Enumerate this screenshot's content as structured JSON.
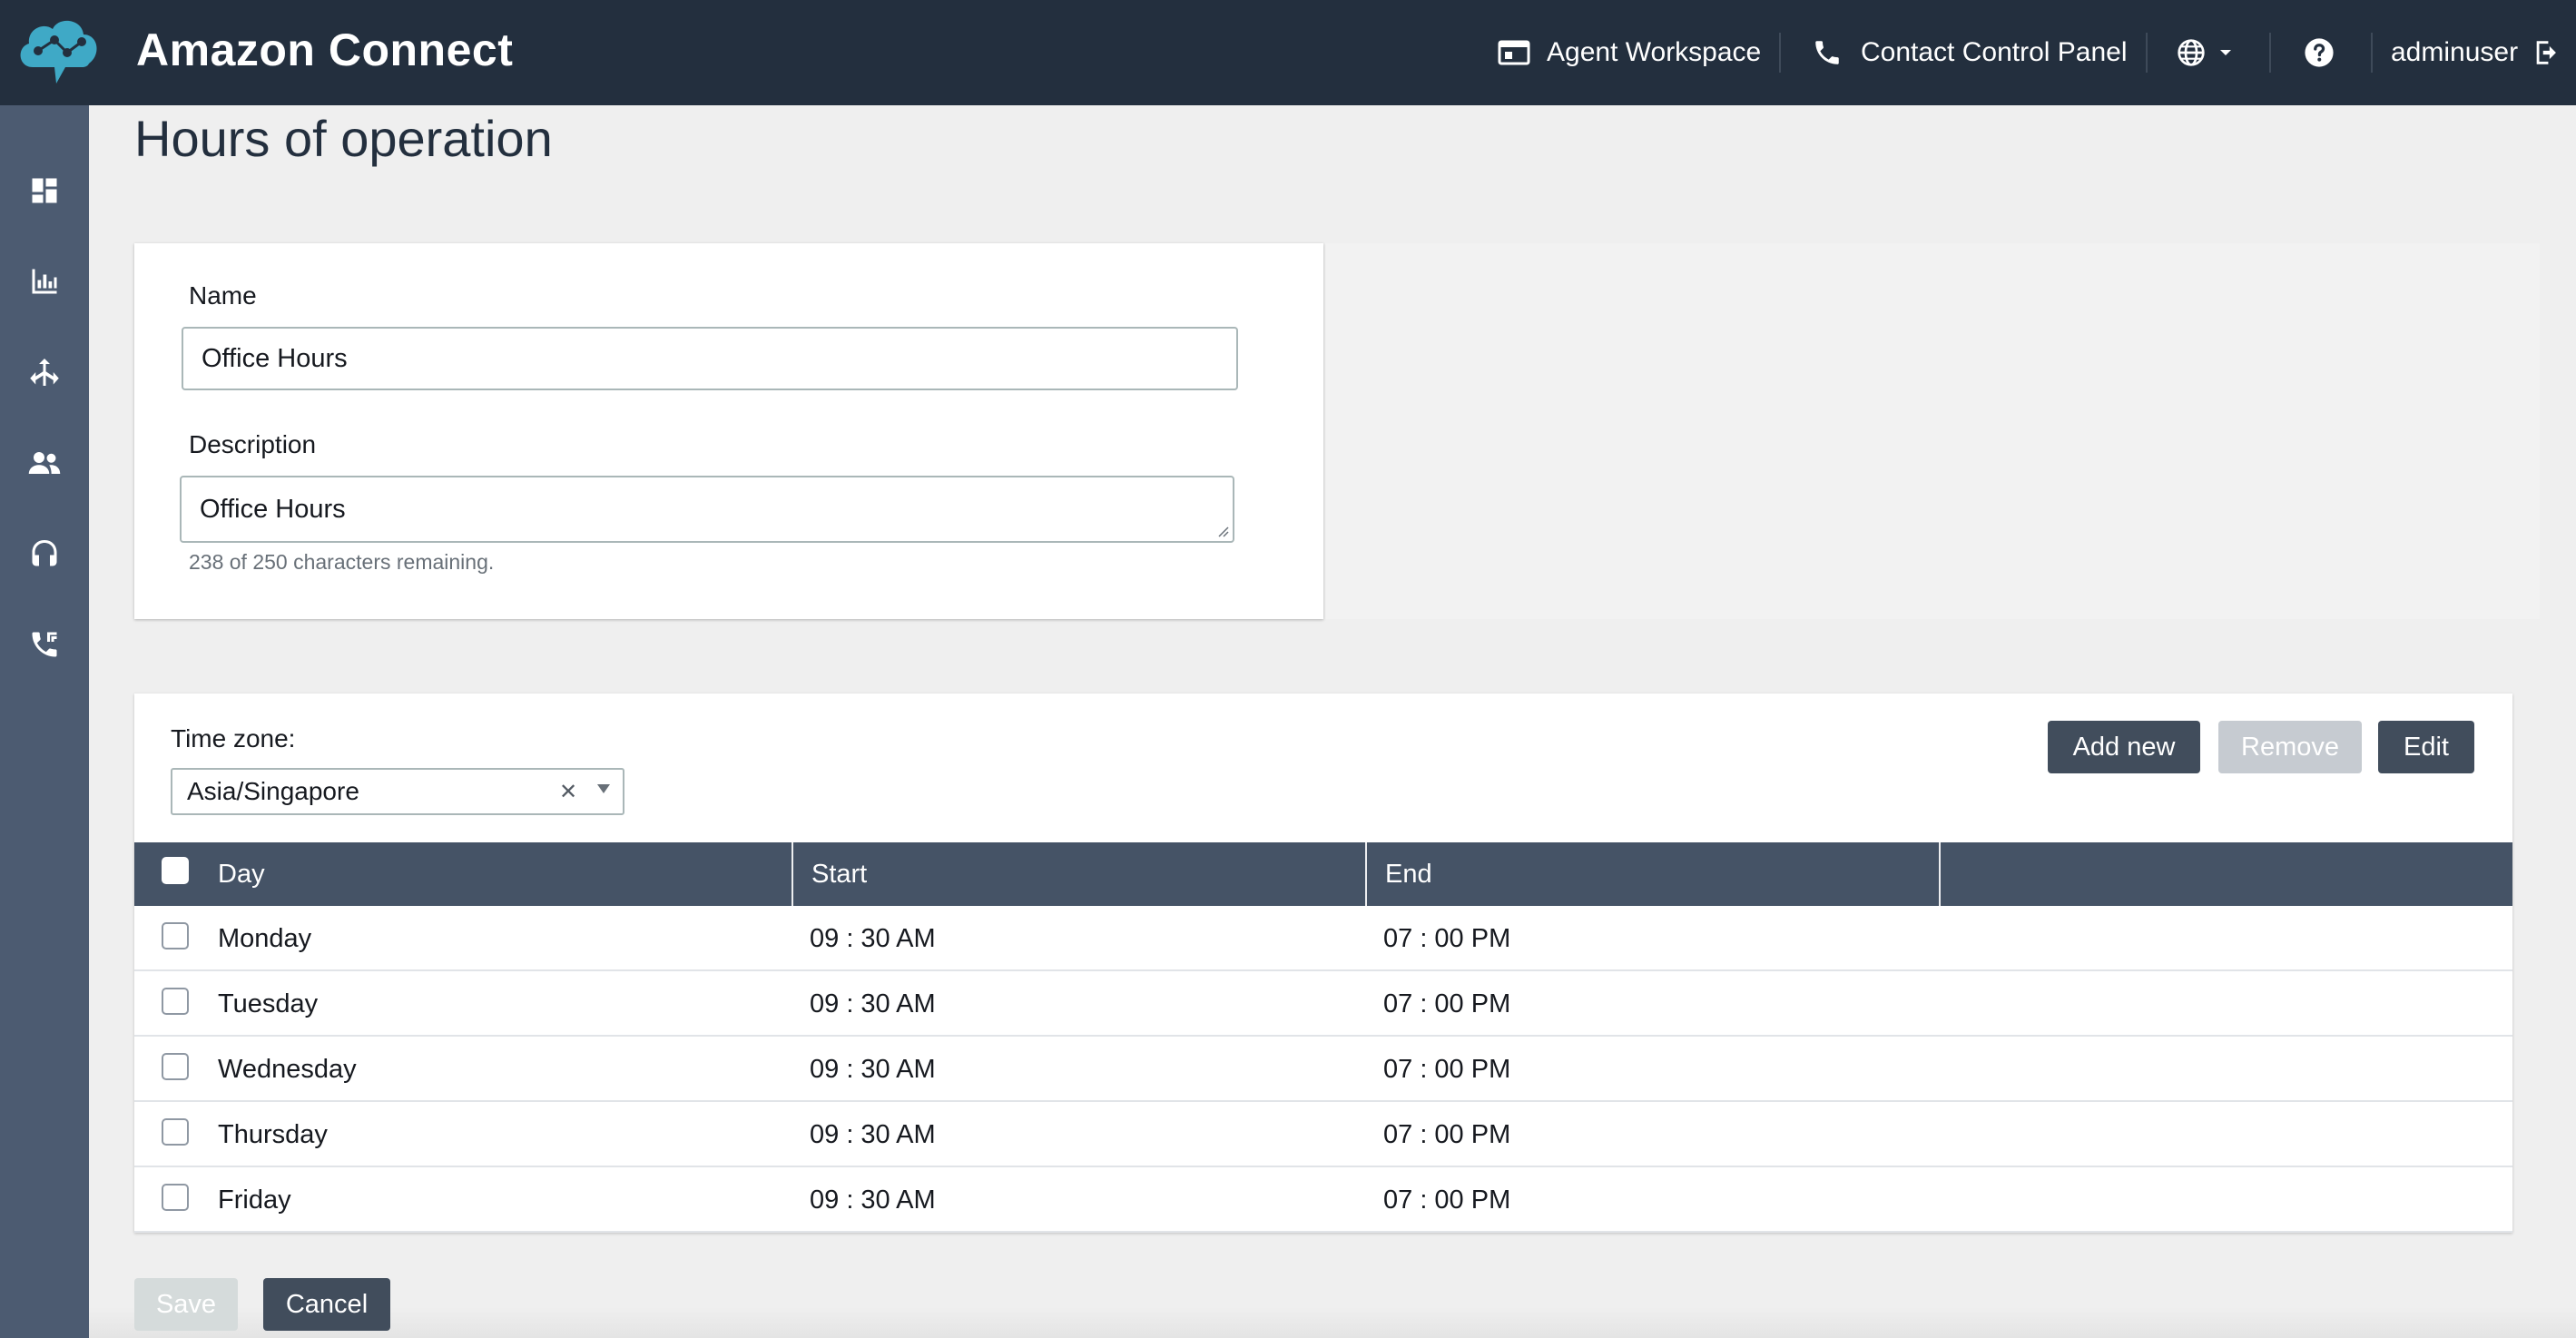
{
  "app": {
    "brand": "Amazon Connect"
  },
  "topbar": {
    "agent_workspace": "Agent Workspace",
    "contact_control_panel": "Contact Control Panel",
    "user": "adminuser"
  },
  "sidebar": {
    "items": [
      {
        "icon": "dashboard-icon"
      },
      {
        "icon": "analytics-icon"
      },
      {
        "icon": "routing-icon"
      },
      {
        "icon": "users-icon"
      },
      {
        "icon": "headset-icon"
      },
      {
        "icon": "phone-icon"
      }
    ]
  },
  "page": {
    "title": "Hours of operation"
  },
  "form": {
    "name_label": "Name",
    "name_value": "Office Hours",
    "description_label": "Description",
    "description_value": "Office Hours",
    "description_hint": "238 of 250 characters remaining."
  },
  "schedule": {
    "timezone_label": "Time zone:",
    "timezone_value": "Asia/Singapore",
    "add_new_label": "Add new",
    "remove_label": "Remove",
    "edit_label": "Edit",
    "columns": [
      "Day",
      "Start",
      "End"
    ],
    "rows": [
      {
        "day": "Monday",
        "start": "09 : 30 AM",
        "end": "07 : 00 PM"
      },
      {
        "day": "Tuesday",
        "start": "09 : 30 AM",
        "end": "07 : 00 PM"
      },
      {
        "day": "Wednesday",
        "start": "09 : 30 AM",
        "end": "07 : 00 PM"
      },
      {
        "day": "Thursday",
        "start": "09 : 30 AM",
        "end": "07 : 00 PM"
      },
      {
        "day": "Friday",
        "start": "09 : 30 AM",
        "end": "07 : 00 PM"
      }
    ]
  },
  "footer": {
    "save_label": "Save",
    "cancel_label": "Cancel"
  },
  "colors": {
    "topbar": "#232f3e",
    "sidebar": "#4c5b71",
    "table_header": "#455366",
    "button_dark": "#414d5c",
    "logo": "#3fa9c6"
  }
}
